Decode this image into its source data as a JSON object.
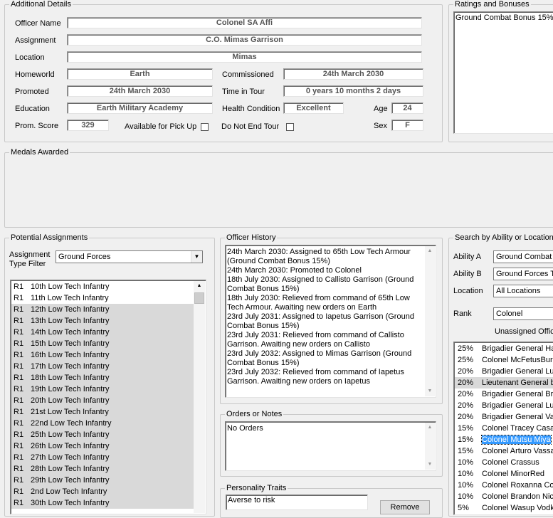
{
  "additional": {
    "title": "Additional Details",
    "officer_name_label": "Officer Name",
    "officer_name": "Colonel SA Affi",
    "assignment_label": "Assignment",
    "assignment": "C.O. Mimas Garrison",
    "location_label": "Location",
    "location": "Mimas",
    "homeworld_label": "Homeworld",
    "homeworld": "Earth",
    "commissioned_label": "Commissioned",
    "commissioned": "24th March 2030",
    "promoted_label": "Promoted",
    "promoted": "24th March 2030",
    "time_in_tour_label": "Time in Tour",
    "time_in_tour": "0 years 10 months 2 days",
    "education_label": "Education",
    "education": "Earth Military Academy",
    "health_label": "Health Condition",
    "health": "Excellent",
    "age_label": "Age",
    "age": "24",
    "prom_score_label": "Prom. Score",
    "prom_score": "329",
    "pickup_label": "Available for Pick Up",
    "not_end_tour_label": "Do Not End Tour",
    "sex_label": "Sex",
    "sex": "F"
  },
  "ratings": {
    "title": "Ratings and Bonuses",
    "items": [
      "Ground Combat Bonus 15%"
    ]
  },
  "medals": {
    "title": "Medals Awarded"
  },
  "potential": {
    "title": "Potential Assignments",
    "filter_label_1": "Assignment",
    "filter_label_2": "Type Filter",
    "filter_value": "Ground Forces",
    "rows": [
      {
        "rank": "R1",
        "name": "10th Low Tech Infantry"
      },
      {
        "rank": "R1",
        "name": "11th Low Tech Infantry"
      },
      {
        "rank": "R1",
        "name": "12th Low Tech Infantry"
      },
      {
        "rank": "R1",
        "name": "13th Low Tech Infantry"
      },
      {
        "rank": "R1",
        "name": "14th Low Tech Infantry"
      },
      {
        "rank": "R1",
        "name": "15th Low Tech Infantry"
      },
      {
        "rank": "R1",
        "name": "16th Low Tech Infantry"
      },
      {
        "rank": "R1",
        "name": "17th Low Tech Infantry"
      },
      {
        "rank": "R1",
        "name": "18th Low Tech Infantry"
      },
      {
        "rank": "R1",
        "name": "19th Low Tech Infantry"
      },
      {
        "rank": "R1",
        "name": "20th Low Tech Infantry"
      },
      {
        "rank": "R1",
        "name": "21st Low Tech Infantry"
      },
      {
        "rank": "R1",
        "name": "22nd Low Tech Infantry"
      },
      {
        "rank": "R1",
        "name": "25th Low Tech Infantry"
      },
      {
        "rank": "R1",
        "name": "26th Low Tech Infantry"
      },
      {
        "rank": "R1",
        "name": "27th Low Tech Infantry"
      },
      {
        "rank": "R1",
        "name": "28th Low Tech Infantry"
      },
      {
        "rank": "R1",
        "name": "29th Low Tech Infantry"
      },
      {
        "rank": "R1",
        "name": "2nd Low Tech Infantry"
      },
      {
        "rank": "R1",
        "name": "30th Low Tech Infantry"
      }
    ]
  },
  "history": {
    "title": "Officer History",
    "lines": [
      "24th March 2030: Assigned to 65th Low Tech Armour",
      "(Ground Combat Bonus 15%)",
      "24th March 2030: Promoted to Colonel",
      "18th July 2030: Assigned to Callisto Garrison (Ground",
      "Combat Bonus 15%)",
      "18th July 2030: Relieved from command of 65th Low",
      "Tech Armour. Awaiting new orders on Earth",
      "23rd July 2031: Assigned to Iapetus Garrison (Ground",
      "Combat Bonus 15%)",
      "23rd July 2031: Relieved from command of Callisto",
      "Garrison. Awaiting new orders on Callisto",
      "23rd July 2032: Assigned to Mimas Garrison (Ground",
      "Combat Bonus 15%)",
      "23rd July 2032: Relieved from command of Iapetus",
      "Garrison. Awaiting new orders on Iapetus"
    ]
  },
  "orders": {
    "title": "Orders or Notes",
    "text": "No Orders"
  },
  "personality": {
    "title": "Personality Traits",
    "items": [
      "Averse to risk"
    ],
    "button": "Remove"
  },
  "search": {
    "title": "Search by Ability or Location",
    "ability_a_label": "Ability A",
    "ability_a": "Ground Combat B",
    "ability_b_label": "Ability B",
    "ability_b": "Ground Forces T",
    "location_label": "Location",
    "location": "All Locations",
    "rank_label": "Rank",
    "rank": "Colonel",
    "unassigned_label": "Unassigned Offic",
    "officers": [
      {
        "pct": "25%",
        "name": "Brigadier General Hay"
      },
      {
        "pct": "25%",
        "name": "Colonel McFetusBurg"
      },
      {
        "pct": "20%",
        "name": "Brigadier General Luc"
      },
      {
        "pct": "20%",
        "name": "Lieutenant General be"
      },
      {
        "pct": "20%",
        "name": "Brigadier General Bru"
      },
      {
        "pct": "20%",
        "name": "Brigadier General Luk"
      },
      {
        "pct": "20%",
        "name": "Brigadier General Val"
      },
      {
        "pct": "15%",
        "name": "Colonel Tracey Casal"
      },
      {
        "pct": "15%",
        "name": "Colonel Mutsu Miya"
      },
      {
        "pct": "15%",
        "name": "Colonel Arturo Vassal"
      },
      {
        "pct": "10%",
        "name": "Colonel Crassus"
      },
      {
        "pct": "10%",
        "name": "Colonel MinorRed"
      },
      {
        "pct": "10%",
        "name": "Colonel Roxanna Cos"
      },
      {
        "pct": "10%",
        "name": "Colonel Brandon Nich"
      },
      {
        "pct": "5%",
        "name": "Colonel Wasup Vodk"
      }
    ]
  },
  "colors": {
    "selection": "#3399ff",
    "window": "#f0f0f0",
    "field_text": "#555555",
    "alt_row": "#d9d9d9"
  }
}
